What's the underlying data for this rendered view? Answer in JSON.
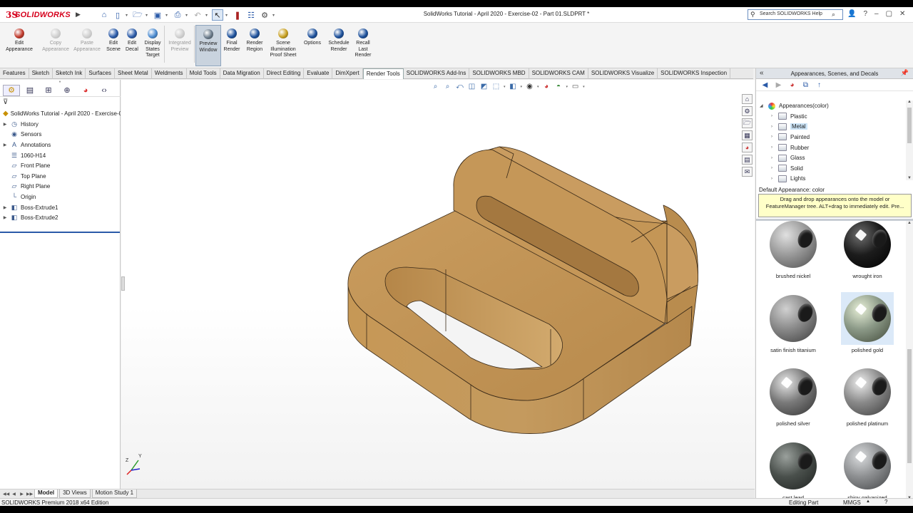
{
  "app": {
    "logo_ds": "3S",
    "logo_text": "SOLIDWORKS",
    "window_title": "SolidWorks Tutorial - April 2020 - Exercise-02 - Part 01.SLDPRT *",
    "search_placeholder": "Search SOLIDWORKS Help"
  },
  "ribbon": [
    {
      "label": "Edit\nAppearance",
      "icon": "edit-appearance-icon",
      "color": "#c0392b",
      "enabled": true,
      "active": false
    },
    {
      "label": "Copy\nAppearance",
      "icon": "copy-appearance-icon",
      "color": "#999999",
      "enabled": false,
      "active": false
    },
    {
      "label": "Paste\nAppearance",
      "icon": "paste-appearance-icon",
      "color": "#999999",
      "enabled": false,
      "active": false
    },
    {
      "label": "Edit\nScene",
      "icon": "edit-scene-icon",
      "color": "#2a5aa8",
      "enabled": true,
      "active": false
    },
    {
      "label": "Edit\nDecal",
      "icon": "edit-decal-icon",
      "color": "#2a5aa8",
      "enabled": true,
      "active": false
    },
    {
      "label": "Display\nStates\nTarget",
      "icon": "display-states-icon",
      "color": "#4a8ad0",
      "enabled": true,
      "active": false
    },
    {
      "label": "Integrated\nPreview",
      "icon": "integrated-preview-icon",
      "color": "#999999",
      "enabled": false,
      "active": false
    },
    {
      "label": "Preview\nWindow",
      "icon": "preview-window-icon",
      "color": "#6a7a8a",
      "enabled": true,
      "active": true
    },
    {
      "label": "Final\nRender",
      "icon": "final-render-icon",
      "color": "#1b4f9a",
      "enabled": true,
      "active": false
    },
    {
      "label": "Render\nRegion",
      "icon": "render-region-icon",
      "color": "#1b4f9a",
      "enabled": true,
      "active": false
    },
    {
      "label": "Scene\nIllumination\nProof Sheet",
      "icon": "proof-sheet-icon",
      "color": "#c8a020",
      "enabled": true,
      "active": false
    },
    {
      "label": "Options",
      "icon": "options-icon",
      "color": "#1b4f9a",
      "enabled": true,
      "active": false
    },
    {
      "label": "Schedule\nRender",
      "icon": "schedule-render-icon",
      "color": "#1b4f9a",
      "enabled": true,
      "active": false
    },
    {
      "label": "Recall\nLast\nRender",
      "icon": "recall-render-icon",
      "color": "#1b4f9a",
      "enabled": true,
      "active": false
    }
  ],
  "command_tabs": [
    "Features",
    "Sketch",
    "Sketch Ink",
    "Surfaces",
    "Sheet Metal",
    "Weldments",
    "Mold Tools",
    "Data Migration",
    "Direct Editing",
    "Evaluate",
    "DimXpert",
    "Render Tools",
    "SOLIDWORKS Add-Ins",
    "SOLIDWORKS MBD",
    "SOLIDWORKS CAM",
    "SOLIDWORKS Visualize",
    "SOLIDWORKS Inspection"
  ],
  "active_command_tab": "Render Tools",
  "feature_tree": {
    "root": "SolidWorks Tutorial - April 2020 - Exercise-0",
    "items": [
      {
        "label": "History",
        "icon": "history-icon",
        "glyph": "◷",
        "expandable": true
      },
      {
        "label": "Sensors",
        "icon": "sensors-icon",
        "glyph": "◉",
        "expandable": false
      },
      {
        "label": "Annotations",
        "icon": "annotations-icon",
        "glyph": "A",
        "expandable": true
      },
      {
        "label": "1060-H14",
        "icon": "material-icon",
        "glyph": "☰",
        "expandable": false
      },
      {
        "label": "Front Plane",
        "icon": "plane-icon",
        "glyph": "▱",
        "expandable": false
      },
      {
        "label": "Top Plane",
        "icon": "plane-icon",
        "glyph": "▱",
        "expandable": false
      },
      {
        "label": "Right Plane",
        "icon": "plane-icon",
        "glyph": "▱",
        "expandable": false
      },
      {
        "label": "Origin",
        "icon": "origin-icon",
        "glyph": "└",
        "expandable": false
      },
      {
        "label": "Boss-Extrude1",
        "icon": "extrude-icon",
        "glyph": "◧",
        "expandable": true
      },
      {
        "label": "Boss-Extrude2",
        "icon": "extrude-icon",
        "glyph": "◧",
        "expandable": true
      }
    ]
  },
  "task_pane": {
    "title": "Appearances, Scenes, and Decals",
    "root": "Appearances(color)",
    "folders": [
      "Plastic",
      "Metal",
      "Painted",
      "Rubber",
      "Glass",
      "Solid",
      "Lights"
    ],
    "selected_folder": "Metal",
    "default_appearance": "Default Appearance: color",
    "tip_line1": "Drag and drop appearances onto the model or",
    "tip_line2": "FeatureManager tree.  ALT+drag to immediately edit.  Pre..."
  },
  "swatches": [
    {
      "label": "brushed nickel",
      "color": "#9a9a9a",
      "highlight": "#e0e0e0",
      "shadow": "#4a4a4a",
      "spec": false
    },
    {
      "label": "wrought iron",
      "color": "#1c1c1c",
      "highlight": "#707070",
      "shadow": "#000000",
      "spec": true
    },
    {
      "label": "satin finish titanium",
      "color": "#8a8a8a",
      "highlight": "#d0d0d0",
      "shadow": "#3a3a3a",
      "spec": false
    },
    {
      "label": "polished gold",
      "color": "#8c9a88",
      "highlight": "#e8f0d8",
      "shadow": "#404838",
      "spec": true,
      "selected": true
    },
    {
      "label": "polished silver",
      "color": "#7a7a7a",
      "highlight": "#e8e8e8",
      "shadow": "#303030",
      "spec": true
    },
    {
      "label": "polished platinum",
      "color": "#8a8a8a",
      "highlight": "#eeeeee",
      "shadow": "#3a3a3a",
      "spec": true
    },
    {
      "label": "cast lead",
      "color": "#4a504c",
      "highlight": "#9aa09c",
      "shadow": "#1e2220",
      "spec": false
    },
    {
      "label": "shiny galvanized",
      "color": "#8e9092",
      "highlight": "#dadcde",
      "shadow": "#404244",
      "spec": true
    }
  ],
  "model": {
    "color": "#c49a5e",
    "dark": "#a87e44",
    "light": "#d4ac70"
  },
  "bottom_tabs": [
    "Model",
    "3D Views",
    "Motion Study 1"
  ],
  "active_bottom_tab": "Model",
  "status": {
    "left": "SOLIDWORKS Premium 2018 x64 Edition",
    "editing": "Editing Part",
    "units": "MMGS"
  }
}
